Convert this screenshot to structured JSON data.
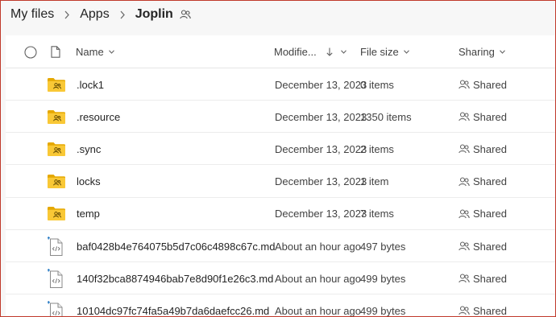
{
  "breadcrumb": {
    "items": [
      "My files",
      "Apps",
      "Joplin"
    ]
  },
  "columns": {
    "name": "Name",
    "modified": "Modifie...",
    "size": "File size",
    "sharing": "Sharing"
  },
  "rows": [
    {
      "type": "folder",
      "name": ".lock1",
      "modified": "December 13, 2023",
      "size": "0 items",
      "sharing": "Shared"
    },
    {
      "type": "folder",
      "name": ".resource",
      "modified": "December 13, 2023",
      "size": "1350 items",
      "sharing": "Shared"
    },
    {
      "type": "folder",
      "name": ".sync",
      "modified": "December 13, 2023",
      "size": "2 items",
      "sharing": "Shared"
    },
    {
      "type": "folder",
      "name": "locks",
      "modified": "December 13, 2023",
      "size": "1 item",
      "sharing": "Shared"
    },
    {
      "type": "folder",
      "name": "temp",
      "modified": "December 13, 2023",
      "size": "7 items",
      "sharing": "Shared"
    },
    {
      "type": "file",
      "name": "baf0428b4e764075b5d7c06c4898c67c.md",
      "modified": "About an hour ago",
      "size": "497 bytes",
      "sharing": "Shared"
    },
    {
      "type": "file",
      "name": "140f32bca8874946bab7e8d90f1e26c3.md",
      "modified": "About an hour ago",
      "size": "499 bytes",
      "sharing": "Shared"
    },
    {
      "type": "file",
      "name": "10104dc97fc74fa5a49b7da6daefcc26.md",
      "modified": "About an hour ago",
      "size": "499 bytes",
      "sharing": "Shared"
    }
  ],
  "colors": {
    "folder": "#f9c836",
    "folder_dark": "#e5a800",
    "accent": "#0f6cbd"
  }
}
